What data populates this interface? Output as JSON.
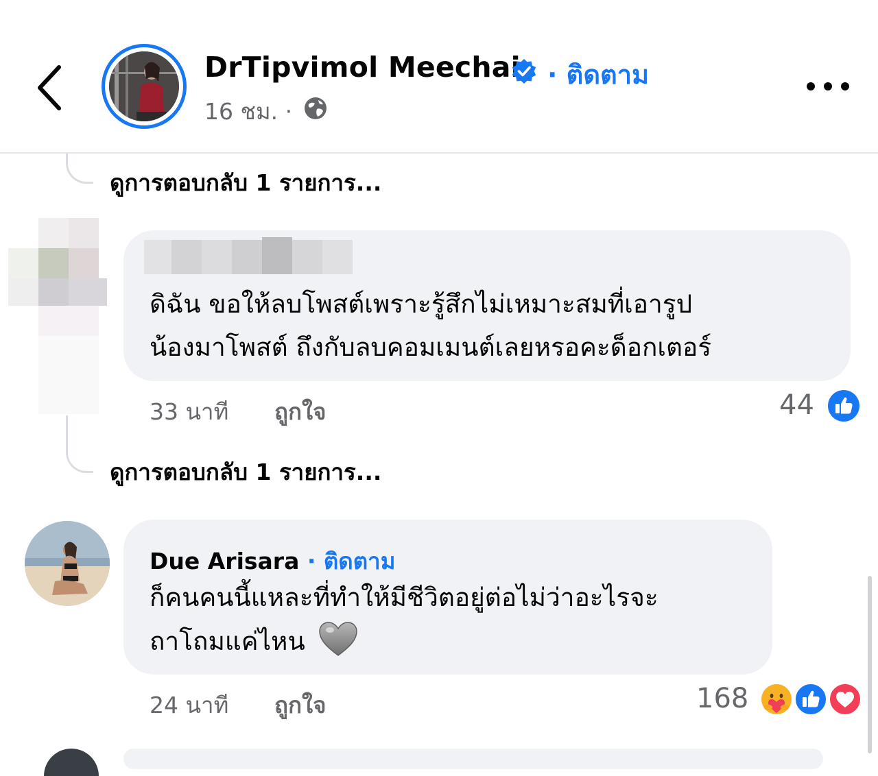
{
  "header": {
    "page_name": "DrTipvimol Meechai",
    "follow_label": "· ติดตาม",
    "post_time": "16 ชม. ·"
  },
  "thread": {
    "view_replies_1": "ดูการตอบกลับ 1 รายการ...",
    "view_replies_2": "ดูการตอบกลับ 1 รายการ..."
  },
  "comments": [
    {
      "text_line1": "ดิฉัน ขอให้ลบโพสต์เพราะรู้สึกไม่เหมาะสมที่เอารูป",
      "text_line2": "น้องมาโพสต์ ถึงกับลบคอมเมนต์เลยหรอคะด็อกเตอร์",
      "time": "33 นาที",
      "like_label": "ถูกใจ",
      "reaction_count": "44"
    },
    {
      "author": "Due Arisara",
      "follow_label": "· ติดตาม",
      "text_line1": "ก็คนคนนี้แหละที่ทำให้มีชีวิตอยู่ต่อไม่ว่าอะไรจะ",
      "text_line2": "ถาโถมแค่ไหน",
      "time": "24 นาที",
      "like_label": "ถูกใจ",
      "reaction_count": "168"
    }
  ],
  "colors": {
    "accent": "#1877f2",
    "bubble": "#f0f2f5",
    "secondary_text": "#65676b",
    "love": "#f33e58",
    "care": "#f7b125"
  },
  "icons": [
    "back-icon",
    "verified-badge-icon",
    "globe-icon",
    "more-icon",
    "like-reaction-icon",
    "care-reaction-icon",
    "love-reaction-icon",
    "grey-heart-emoji"
  ]
}
